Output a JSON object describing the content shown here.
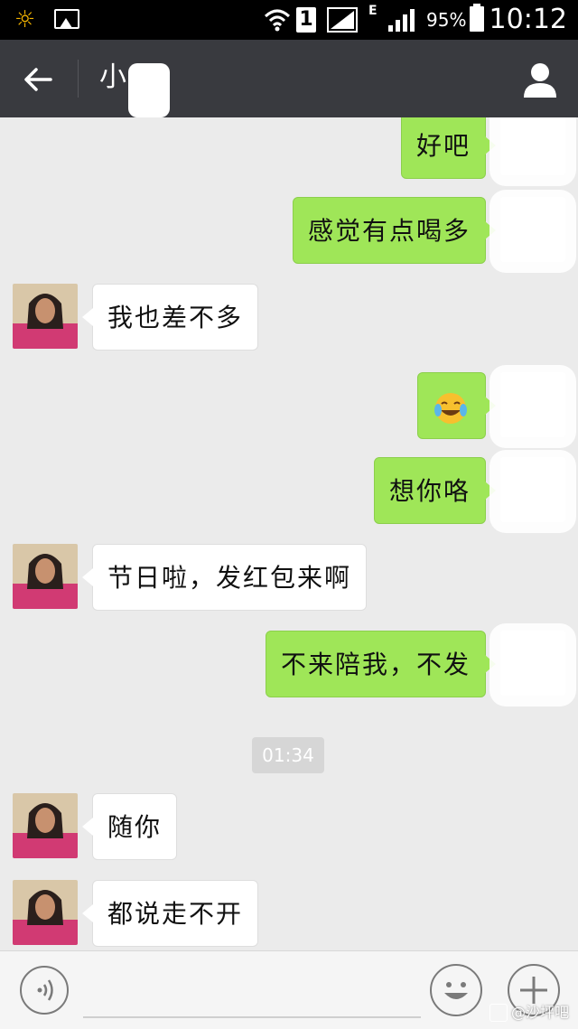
{
  "status_bar": {
    "sim_slot": "1",
    "network_type": "E",
    "battery": "95%",
    "time": "10:12"
  },
  "header": {
    "title": "小"
  },
  "messages": [
    {
      "side": "out",
      "text": "好吧"
    },
    {
      "side": "out",
      "text": "感觉有点喝多"
    },
    {
      "side": "in",
      "text": "我也差不多"
    },
    {
      "side": "out",
      "emoji": "face-with-tears-of-joy-icon"
    },
    {
      "side": "out",
      "text": "想你咯"
    },
    {
      "side": "in",
      "text": "节日啦，发红包来啊"
    },
    {
      "side": "out",
      "text": "不来陪我，不发"
    },
    {
      "side": "in",
      "text": "随你"
    },
    {
      "side": "in",
      "text": "都说走不开"
    }
  ],
  "timestamp": "01:34",
  "input": {
    "value": "",
    "placeholder": ""
  },
  "watermark": "@沙坪吧",
  "colors": {
    "outgoing_bubble": "#9fe658",
    "incoming_bubble": "#ffffff",
    "header_bg": "#393a3f",
    "chat_bg": "#ebebeb"
  }
}
